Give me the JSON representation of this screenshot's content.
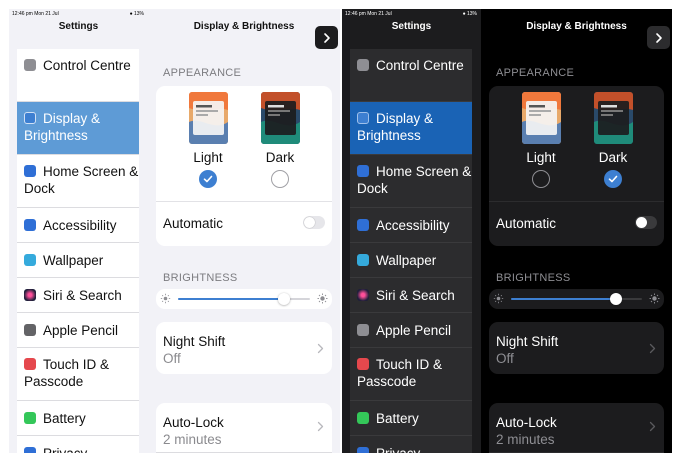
{
  "colors": {
    "accent": "#3d7fd1",
    "light_selected": "#5e9bd6",
    "dark_selected": "#1a63b5"
  },
  "screens": [
    {
      "theme": "light",
      "status": {
        "time": "12:46 pm  Mon 21 Jul",
        "battery": "13%"
      },
      "sidebar": {
        "title": "Settings",
        "items": [
          {
            "label": "Control Centre",
            "icon": "control-centre-icon",
            "icon_color": "#8e8e93"
          },
          {
            "label": "Display & Brightness",
            "icon": "display-icon",
            "icon_color": "#3d7fd1",
            "selected": true
          },
          {
            "label": "Home Screen & Dock",
            "icon": "home-screen-icon",
            "icon_color": "#2f6fd6"
          },
          {
            "label": "Accessibility",
            "icon": "accessibility-icon",
            "icon_color": "#2f6fd6"
          },
          {
            "label": "Wallpaper",
            "icon": "wallpaper-icon",
            "icon_color": "#35aadc"
          },
          {
            "label": "Siri & Search",
            "icon": "siri-icon",
            "icon_color": "#1f1f3a"
          },
          {
            "label": "Apple Pencil",
            "icon": "pencil-icon",
            "icon_color": "#636366"
          },
          {
            "label": "Touch ID & Passcode",
            "icon": "touch-id-icon",
            "icon_color": "#e5484d"
          },
          {
            "label": "Battery",
            "icon": "battery-icon",
            "icon_color": "#34c759"
          },
          {
            "label": "Privacy",
            "icon": "privacy-icon",
            "icon_color": "#2f6fd6"
          }
        ]
      },
      "detail": {
        "title": "Display & Brightness",
        "appearance_header": "APPEARANCE",
        "modes": [
          {
            "label": "Light"
          },
          {
            "label": "Dark"
          }
        ],
        "selected_mode": "Light",
        "automatic": {
          "label": "Automatic",
          "on": false
        },
        "brightness_header": "BRIGHTNESS",
        "brightness_level": 0.8,
        "night_shift": {
          "title": "Night Shift",
          "value": "Off"
        },
        "auto_lock": {
          "title": "Auto-Lock",
          "value": "2 minutes"
        }
      }
    },
    {
      "theme": "dark",
      "status": {
        "time": "12:46 pm  Mon 21 Jul",
        "battery": "13%"
      },
      "sidebar": {
        "title": "Settings",
        "items": [
          {
            "label": "Control Centre",
            "icon": "control-centre-icon",
            "icon_color": "#8e8e93"
          },
          {
            "label": "Display & Brightness",
            "icon": "display-icon",
            "icon_color": "#3d7fd1",
            "selected": true
          },
          {
            "label": "Home Screen & Dock",
            "icon": "home-screen-icon",
            "icon_color": "#2f6fd6"
          },
          {
            "label": "Accessibility",
            "icon": "accessibility-icon",
            "icon_color": "#2f6fd6"
          },
          {
            "label": "Wallpaper",
            "icon": "wallpaper-icon",
            "icon_color": "#35aadc"
          },
          {
            "label": "Siri & Search",
            "icon": "siri-icon",
            "icon_color": "#1f1f3a"
          },
          {
            "label": "Apple Pencil",
            "icon": "pencil-icon",
            "icon_color": "#8e8e93"
          },
          {
            "label": "Touch ID & Passcode",
            "icon": "touch-id-icon",
            "icon_color": "#e5484d"
          },
          {
            "label": "Battery",
            "icon": "battery-icon",
            "icon_color": "#34c759"
          },
          {
            "label": "Privacy",
            "icon": "privacy-icon",
            "icon_color": "#2f6fd6"
          }
        ]
      },
      "detail": {
        "title": "Display & Brightness",
        "appearance_header": "APPEARANCE",
        "modes": [
          {
            "label": "Light"
          },
          {
            "label": "Dark"
          }
        ],
        "selected_mode": "Dark",
        "automatic": {
          "label": "Automatic",
          "on": false
        },
        "brightness_header": "BRIGHTNESS",
        "brightness_level": 0.8,
        "night_shift": {
          "title": "Night Shift",
          "value": "Off"
        },
        "auto_lock": {
          "title": "Auto-Lock",
          "value": "2 minutes"
        }
      }
    }
  ]
}
